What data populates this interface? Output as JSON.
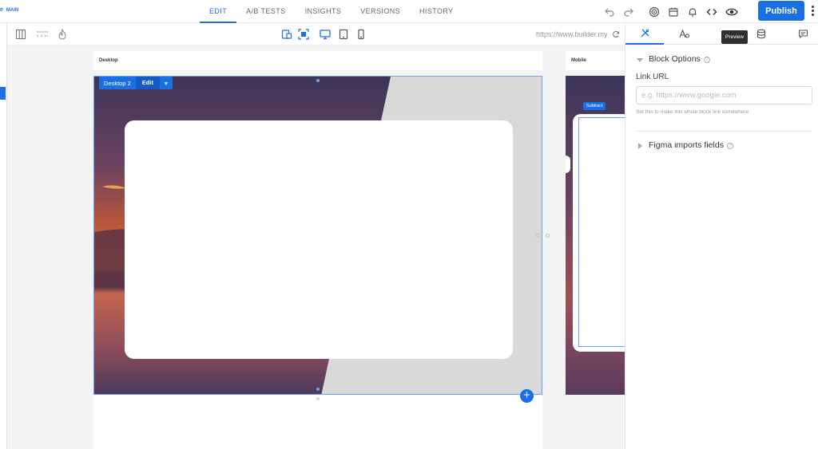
{
  "brand": {
    "label": "MAIN"
  },
  "tabs": [
    {
      "label": "EDIT",
      "active": true
    },
    {
      "label": "A/B TESTS"
    },
    {
      "label": "INSIGHTS"
    },
    {
      "label": "VERSIONS"
    },
    {
      "label": "HISTORY"
    }
  ],
  "header": {
    "publish_label": "Publish"
  },
  "toolbar": {
    "url": "https://www.builder.my"
  },
  "canvas": {
    "desktop_label": "Desktop",
    "mobile_label": "Mobile",
    "block_name": "Desktop 2",
    "block_edit": "Edit",
    "mobile_chip": "Subtract"
  },
  "panel": {
    "tooltip": "Preview",
    "block_options_title": "Block Options",
    "link_url_label": "Link URL",
    "link_url_placeholder": "e.g. https://www.google.com",
    "link_url_help": "Set this to make this whole block link somewhere",
    "figma_title": "Figma imports fields"
  },
  "colors": {
    "accent": "#1b6fe4"
  }
}
